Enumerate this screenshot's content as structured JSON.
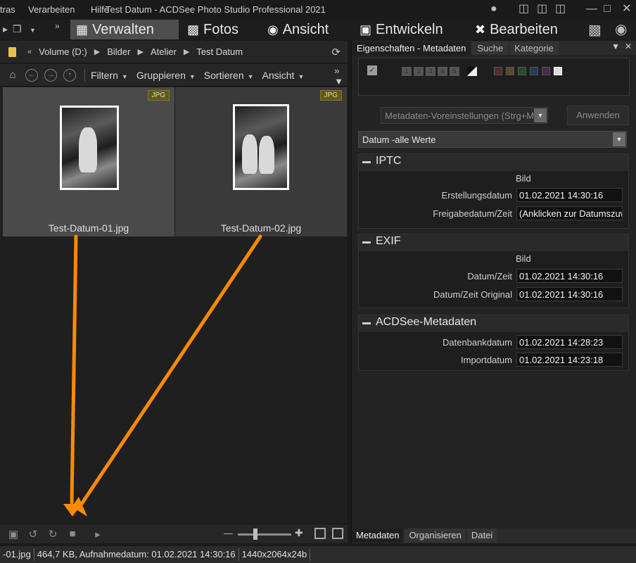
{
  "window": {
    "menu": [
      "tras",
      "Verarbeiten",
      "Hilfe"
    ],
    "title": "Test Datum - ACDSee Photo Studio Professional 2021"
  },
  "modes": {
    "items": [
      {
        "label": "Verwalten",
        "icon": "grid-icon"
      },
      {
        "label": "Fotos",
        "icon": "photos-icon"
      },
      {
        "label": "Ansicht",
        "icon": "eye-icon"
      },
      {
        "label": "Entwickeln",
        "icon": "develop-icon"
      },
      {
        "label": "Bearbeiten",
        "icon": "edit-icon"
      }
    ],
    "active": "Verwalten"
  },
  "breadcrumb": {
    "items": [
      "Volume (D:)",
      "Bilder",
      "Atelier",
      "Test Datum"
    ]
  },
  "toolbar": {
    "filter": "Filtern",
    "group": "Gruppieren",
    "sort": "Sortieren",
    "view": "Ansicht"
  },
  "files": [
    {
      "name": "Test-Datum-01.jpg",
      "badge": "JPG",
      "selected": true
    },
    {
      "name": "Test-Datum-02.jpg",
      "badge": "JPG",
      "selected": false
    }
  ],
  "properties": {
    "tabs": [
      "Eigenschaften - Metadaten",
      "Suche",
      "Kategorie"
    ],
    "active_tab": "Eigenschaften - Metadaten",
    "ratings": [
      "1",
      "2",
      "3",
      "4",
      "5"
    ],
    "preset_placeholder": "Metadaten-Voreinstellungen (Strg+M)",
    "apply_label": "Anwenden",
    "filter_value": "Datum -alle Werte",
    "sections": {
      "iptc": {
        "title": "IPTC",
        "column": "Bild",
        "rows": [
          {
            "label": "Erstellungsdatum",
            "value": "01.02.2021 14:30:16"
          },
          {
            "label": "Freigabedatum/Zeit",
            "value": "(Anklicken zur Datumszuw"
          }
        ]
      },
      "exif": {
        "title": "EXIF",
        "column": "Bild",
        "rows": [
          {
            "label": "Datum/Zeit",
            "value": "01.02.2021 14:30:16"
          },
          {
            "label": "Datum/Zeit Original",
            "value": "01.02.2021 14:30:16"
          }
        ]
      },
      "acdsee": {
        "title": "ACDSee-Metadaten",
        "rows": [
          {
            "label": "Datenbankdatum",
            "value": "01.02.2021 14:28:23"
          },
          {
            "label": "Importdatum",
            "value": "01.02.2021 14:23:18"
          }
        ]
      }
    },
    "bottom_tabs": [
      "Metadaten",
      "Organisieren",
      "Datei"
    ],
    "active_bottom_tab": "Metadaten"
  },
  "status": {
    "file": "-01.jpg",
    "info": "464,7 KB, Aufnahmedatum: 01.02.2021 14:30:16",
    "dimensions": "1440x2064x24b"
  },
  "colors": {
    "accent_arrow": "#ff8a00",
    "active_mode_bg": "#4e4e4e",
    "badge_bg": "#5e5a1e"
  }
}
